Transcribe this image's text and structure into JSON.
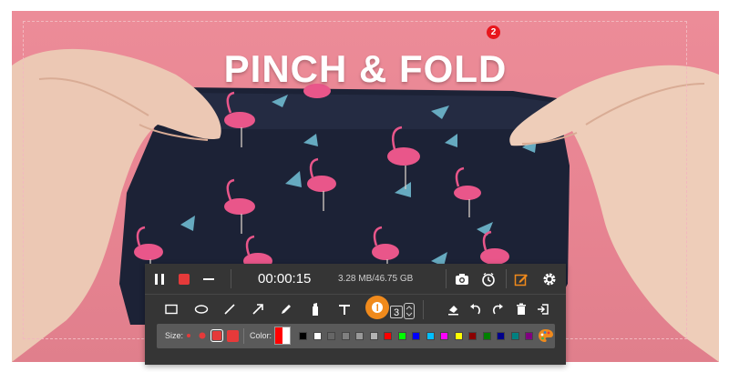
{
  "video": {
    "title": "PINCH & FOLD",
    "badge_number": "2"
  },
  "toolbar": {
    "timer": "00:00:15",
    "file_size": "3.28 MB/46.75 GB",
    "step_value": "3",
    "size_label": "Size:",
    "color_label": "Color:",
    "sizes": [
      "small",
      "medium",
      "large",
      "x-large"
    ],
    "selected_size_index": 2,
    "current_color": "#ff0000",
    "accent_color": "#f08a1c",
    "colors": [
      "#000000",
      "#ffffff",
      "#666666",
      "#808080",
      "#999999",
      "#b3b3b3",
      "#ff0000",
      "#00ff00",
      "#0000ff",
      "#00bfff",
      "#ff00ff",
      "#ffff00",
      "#8b0000",
      "#008000",
      "#00008b",
      "#008080",
      "#800080"
    ],
    "icons": [
      "pause-icon",
      "stop-icon",
      "minimize-icon",
      "camera-icon",
      "timer-icon",
      "edit-icon",
      "settings-icon",
      "rectangle-icon",
      "ellipse-icon",
      "line-icon",
      "arrow-icon",
      "pen-icon",
      "highlighter-icon",
      "text-icon",
      "step-number-icon",
      "eraser-icon",
      "undo-icon",
      "redo-icon",
      "trash-icon",
      "exit-icon",
      "palette-icon"
    ]
  }
}
